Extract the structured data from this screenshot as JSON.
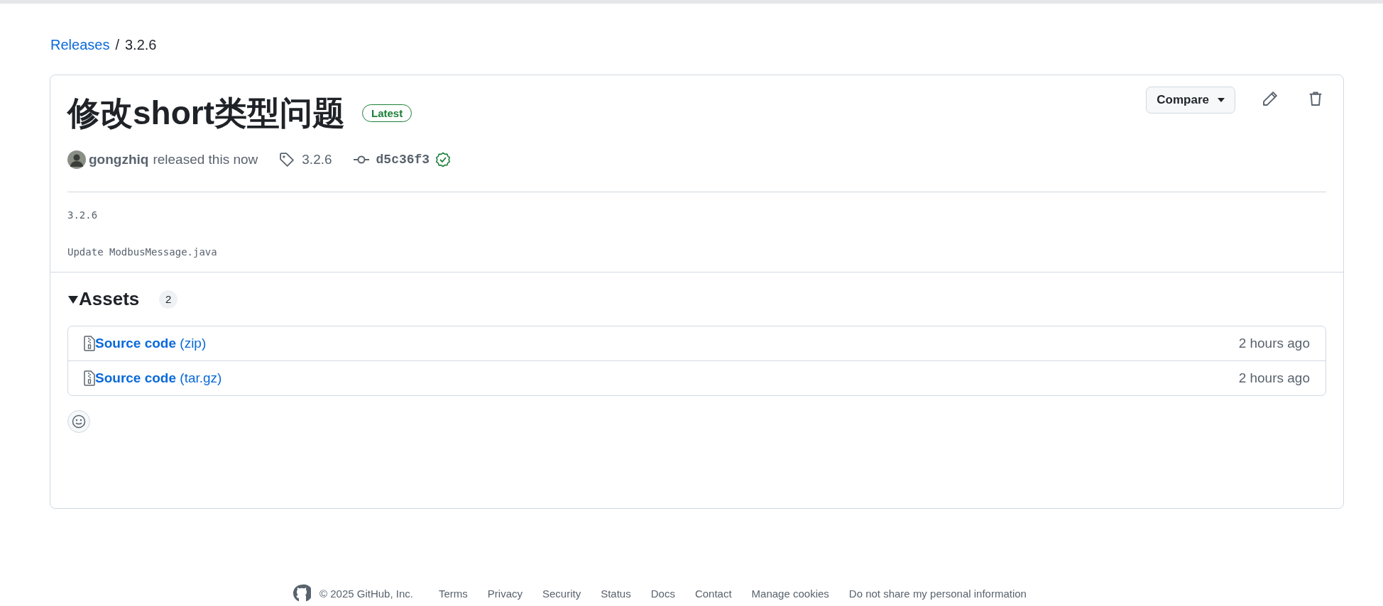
{
  "breadcrumb": {
    "parent": "Releases",
    "separator": "/",
    "current": "3.2.6"
  },
  "release": {
    "title": "修改short类型问题",
    "badge": "Latest",
    "compare": "Compare",
    "author": "gongzhiq",
    "action": "released this now",
    "tag": "3.2.6",
    "commit": "d5c36f3",
    "verified": true,
    "notes": [
      "3.2.6",
      "Update ModbusMessage.java"
    ],
    "assets": {
      "title": "Assets",
      "expanded": true,
      "count": "2",
      "items": [
        {
          "name": "Source code",
          "format": "(zip)",
          "time": "2 hours ago"
        },
        {
          "name": "Source code",
          "format": "(tar.gz)",
          "time": "2 hours ago"
        }
      ]
    }
  },
  "footer": {
    "copyright": "© 2025 GitHub, Inc.",
    "links": [
      "Terms",
      "Privacy",
      "Security",
      "Status",
      "Docs",
      "Contact",
      "Manage cookies",
      "Do not share my personal information"
    ]
  }
}
